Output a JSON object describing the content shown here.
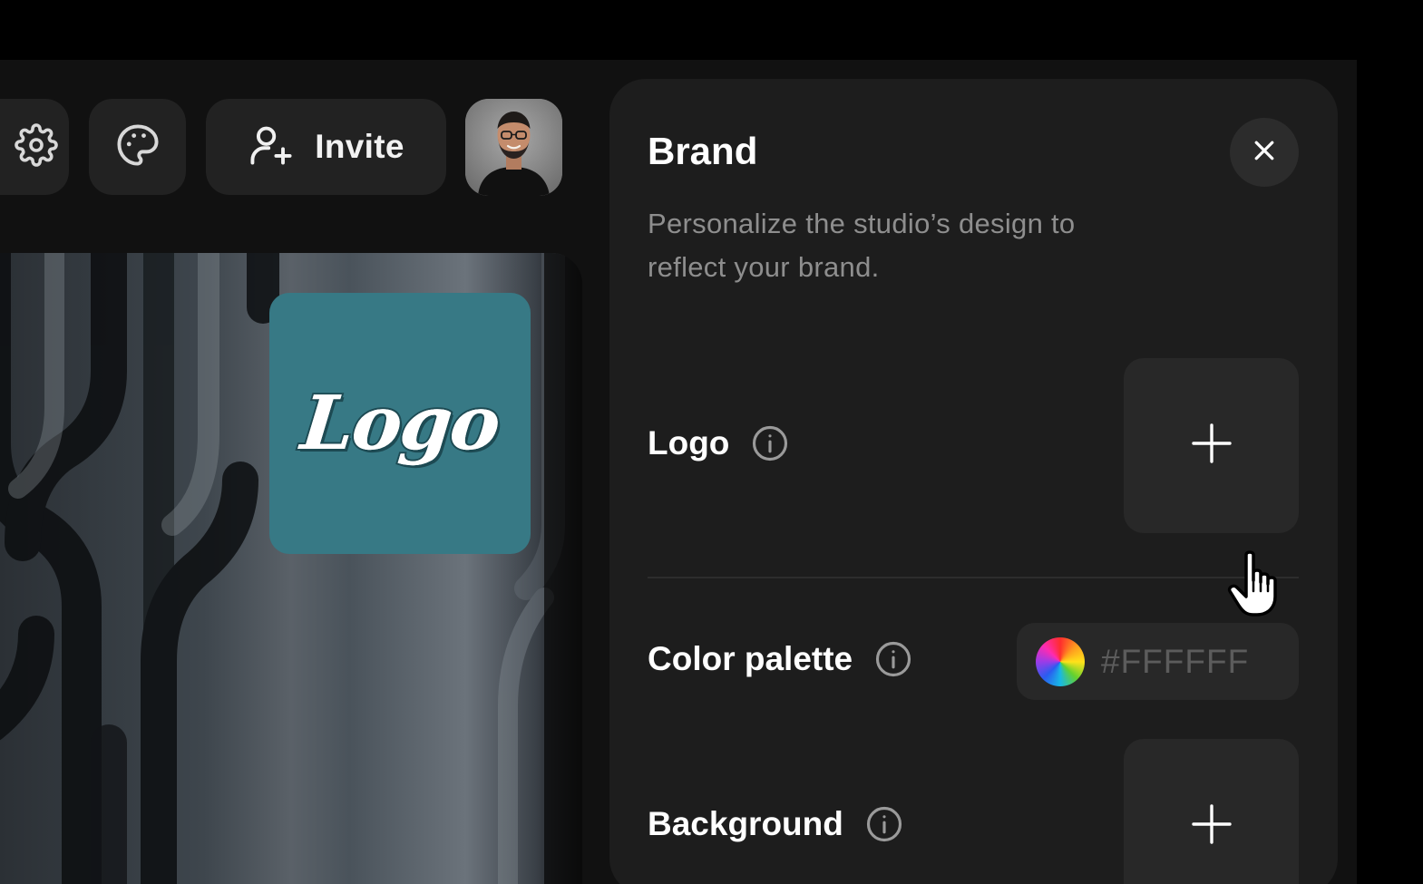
{
  "toolbar": {
    "settings_icon": "gear-icon",
    "palette_icon": "palette-icon",
    "invite_icon": "user-plus-icon",
    "invite_label": "Invite"
  },
  "preview": {
    "logo_text": "Logo",
    "logo_tile_color": "#377985"
  },
  "brand_panel": {
    "title": "Brand",
    "description": "Personalize the studio’s design to reflect your brand.",
    "close_icon": "close-icon",
    "logo": {
      "label": "Logo",
      "info_icon": "info-icon",
      "add_icon": "plus-icon"
    },
    "color_palette": {
      "label": "Color palette",
      "info_icon": "info-icon",
      "value": "#FFFFFF"
    },
    "background": {
      "label": "Background",
      "info_icon": "info-icon",
      "add_icon": "plus-icon"
    }
  },
  "colors": {
    "app_background": "#111111",
    "panel_background": "#1d1d1d",
    "control_background": "#282828",
    "muted_text": "#8e8e8e"
  }
}
